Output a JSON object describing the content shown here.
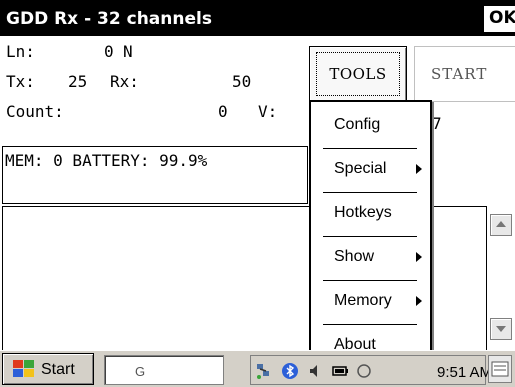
{
  "window": {
    "title": "GDD Rx - 32 channels",
    "ok_label": "OK"
  },
  "status": {
    "ln_label": "Ln:",
    "ln_value": "0",
    "ln_flag": "N",
    "tx_label": "Tx:",
    "tx_value": "25",
    "rx_label": "Rx:",
    "rx_value": "50",
    "count_label": "Count:",
    "count_value": "0",
    "v_label": "V:",
    "v_value_partial": "7",
    "mem_line": "MEM: 0 BATTERY: 99.9%"
  },
  "toolbar": {
    "tools_label": "TOOLS",
    "start_label": "START"
  },
  "menu": {
    "items": [
      {
        "label": "Config",
        "submenu": false
      },
      {
        "label": "Special",
        "submenu": true
      },
      {
        "label": "Hotkeys",
        "submenu": false
      },
      {
        "label": "Show",
        "submenu": true
      },
      {
        "label": "Memory",
        "submenu": true
      },
      {
        "label": "About",
        "submenu": false
      }
    ]
  },
  "taskbar": {
    "start_label": "Start",
    "input_partial": "G",
    "clock": "9:51 AM",
    "icons": [
      "network-icon",
      "bluetooth-icon",
      "volume-icon",
      "battery-icon",
      "keyboard-icon"
    ]
  },
  "colors": {
    "titlebar": "#000000",
    "taskbar": "#d4d0c8",
    "menu_bg": "#ffffff",
    "start_flag_red": "#e03a1c",
    "start_flag_green": "#3aa53a",
    "start_flag_blue": "#2c5fd8",
    "start_flag_yellow": "#f2c21a"
  }
}
